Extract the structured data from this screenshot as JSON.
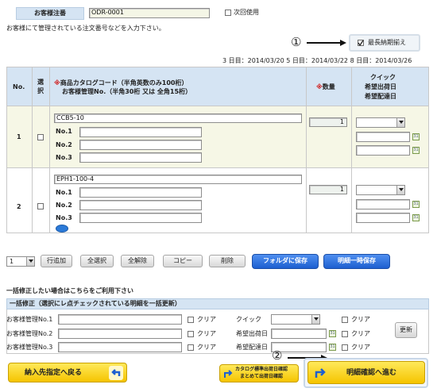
{
  "order": {
    "label": "お客様注番",
    "value": "ODR-0001",
    "next_use": "次回使用",
    "hint": "お客様にて管理されている注文番号などを入力下さい。"
  },
  "annotations": {
    "one": "①",
    "two": "②"
  },
  "deadline": {
    "label": "最長納期揃え"
  },
  "dates": "3 日目：2014/03/20  5 日目：2014/03/22  8 日目：2014/03/26",
  "table": {
    "headers": {
      "no": "No.",
      "select": "選\n択",
      "catalog_mark": "※",
      "catalog_line1": "商品カタログコード（半角英数のみ100桁）",
      "catalog_line2": "お客様管理No.（半角30桁 又は 全角15桁）",
      "qty_mark": "※",
      "qty": "数量",
      "quick1": "クイック",
      "quick2": "希望出荷日",
      "quick3": "希望配達日"
    },
    "rows": [
      {
        "no": "1",
        "code": "CCB5-10",
        "qty": "1",
        "labels": [
          "No.1",
          "No.2",
          "No.3"
        ]
      },
      {
        "no": "2",
        "code": "EPH1-100-4",
        "qty": "1",
        "labels": [
          "No.1",
          "No.2",
          "No.3"
        ]
      }
    ]
  },
  "toolbar": {
    "count": "1",
    "add_row": "行追加",
    "select_all": "全選択",
    "deselect_all": "全解除",
    "copy": "コピー",
    "delete": "削除",
    "save_folder": "フォルダに保存",
    "temp_save": "明細一時保存"
  },
  "bulk": {
    "intro": "一括修正したい場合はこちらをご利用下さい",
    "title": "一括修正（選択にレ点チェックされている明細を一括更新）",
    "fields": [
      "お客様管理No.1",
      "お客様管理No.2",
      "お客様管理No.3"
    ],
    "clear": "クリア",
    "quick": "クイック",
    "ship": "希望出荷日",
    "deliver": "希望配達日",
    "update": "更新"
  },
  "footer": {
    "back": "納入先指定へ戻る",
    "catalog_line1": "カタログ標準出荷日確認",
    "catalog_line2": "まとめて出荷日確認",
    "next": "明細確認へ進む"
  },
  "colors": {
    "accent_blue": "#1d5fd0",
    "header_blue": "#d5e4f3",
    "yellow": "#f5c400",
    "highlight": "#f6f7e6"
  }
}
